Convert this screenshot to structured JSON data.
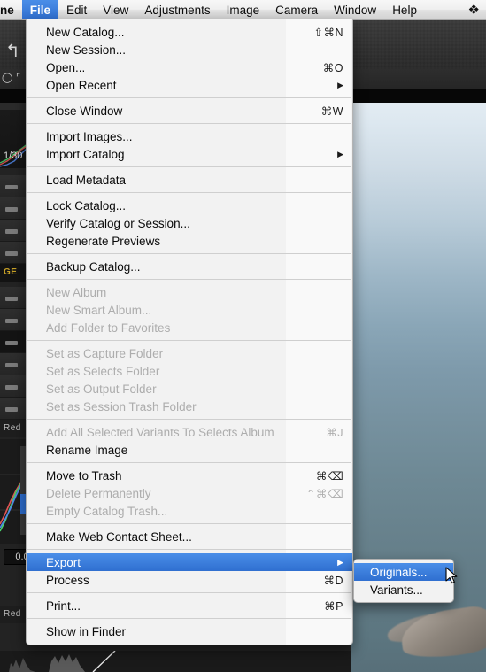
{
  "menubar": {
    "app_name": "ne",
    "items": [
      {
        "label": "File",
        "active": true
      },
      {
        "label": "Edit",
        "active": false
      },
      {
        "label": "View",
        "active": false
      },
      {
        "label": "Adjustments",
        "active": false
      },
      {
        "label": "Image",
        "active": false
      },
      {
        "label": "Camera",
        "active": false
      },
      {
        "label": "Window",
        "active": false
      },
      {
        "label": "Help",
        "active": false
      }
    ],
    "status_icon": "dropbox-icon",
    "status_glyph": "❖",
    "highlight_color": "#2f6fd0"
  },
  "file_menu": {
    "groups": [
      [
        {
          "label": "New Catalog...",
          "shortcut": "⇧⌘N",
          "enabled": true,
          "submenu": false,
          "selected": false
        },
        {
          "label": "New Session...",
          "shortcut": "",
          "enabled": true,
          "submenu": false,
          "selected": false
        },
        {
          "label": "Open...",
          "shortcut": "⌘O",
          "enabled": true,
          "submenu": false,
          "selected": false
        },
        {
          "label": "Open Recent",
          "shortcut": "",
          "enabled": true,
          "submenu": true,
          "selected": false
        }
      ],
      [
        {
          "label": "Close Window",
          "shortcut": "⌘W",
          "enabled": true,
          "submenu": false,
          "selected": false
        }
      ],
      [
        {
          "label": "Import Images...",
          "shortcut": "",
          "enabled": true,
          "submenu": false,
          "selected": false
        },
        {
          "label": "Import Catalog",
          "shortcut": "",
          "enabled": true,
          "submenu": true,
          "selected": false
        }
      ],
      [
        {
          "label": "Load Metadata",
          "shortcut": "",
          "enabled": true,
          "submenu": false,
          "selected": false
        }
      ],
      [
        {
          "label": "Lock Catalog...",
          "shortcut": "",
          "enabled": true,
          "submenu": false,
          "selected": false
        },
        {
          "label": "Verify Catalog or Session...",
          "shortcut": "",
          "enabled": true,
          "submenu": false,
          "selected": false
        },
        {
          "label": "Regenerate Previews",
          "shortcut": "",
          "enabled": true,
          "submenu": false,
          "selected": false
        }
      ],
      [
        {
          "label": "Backup Catalog...",
          "shortcut": "",
          "enabled": true,
          "submenu": false,
          "selected": false
        }
      ],
      [
        {
          "label": "New Album",
          "shortcut": "",
          "enabled": false,
          "submenu": false,
          "selected": false
        },
        {
          "label": "New Smart Album...",
          "shortcut": "",
          "enabled": false,
          "submenu": false,
          "selected": false
        },
        {
          "label": "Add Folder to Favorites",
          "shortcut": "",
          "enabled": false,
          "submenu": false,
          "selected": false
        }
      ],
      [
        {
          "label": "Set as Capture Folder",
          "shortcut": "",
          "enabled": false,
          "submenu": false,
          "selected": false
        },
        {
          "label": "Set as Selects Folder",
          "shortcut": "",
          "enabled": false,
          "submenu": false,
          "selected": false
        },
        {
          "label": "Set as Output Folder",
          "shortcut": "",
          "enabled": false,
          "submenu": false,
          "selected": false
        },
        {
          "label": "Set as Session Trash Folder",
          "shortcut": "",
          "enabled": false,
          "submenu": false,
          "selected": false
        }
      ],
      [
        {
          "label": "Add All Selected Variants To Selects Album",
          "shortcut": "⌘J",
          "enabled": false,
          "submenu": false,
          "selected": false
        },
        {
          "label": "Rename Image",
          "shortcut": "",
          "enabled": true,
          "submenu": false,
          "selected": false
        }
      ],
      [
        {
          "label": "Move to Trash",
          "shortcut": "⌘⌫",
          "enabled": true,
          "submenu": false,
          "selected": false
        },
        {
          "label": "Delete Permanently",
          "shortcut": "⌃⌘⌫",
          "enabled": false,
          "submenu": false,
          "selected": false
        },
        {
          "label": "Empty Catalog Trash...",
          "shortcut": "",
          "enabled": false,
          "submenu": false,
          "selected": false
        }
      ],
      [
        {
          "label": "Make Web Contact Sheet...",
          "shortcut": "",
          "enabled": true,
          "submenu": false,
          "selected": false
        }
      ],
      [
        {
          "label": "Export",
          "shortcut": "",
          "enabled": true,
          "submenu": true,
          "selected": true
        },
        {
          "label": "Process",
          "shortcut": "⌘D",
          "enabled": true,
          "submenu": false,
          "selected": false
        }
      ],
      [
        {
          "label": "Print...",
          "shortcut": "⌘P",
          "enabled": true,
          "submenu": false,
          "selected": false
        }
      ],
      [
        {
          "label": "Show in Finder",
          "shortcut": "",
          "enabled": true,
          "submenu": false,
          "selected": false
        }
      ]
    ]
  },
  "export_submenu": {
    "items": [
      {
        "label": "Originals...",
        "selected": true
      },
      {
        "label": "Variants...",
        "selected": false
      }
    ]
  },
  "app_background": {
    "undo_icon": "undo-arrow-icon",
    "undo_glyph": "↰",
    "exposure_value": "1/30",
    "curve_value": "0.0",
    "channel_label_1": "Red",
    "channel_label_2": "Red",
    "section_label": "GE"
  }
}
